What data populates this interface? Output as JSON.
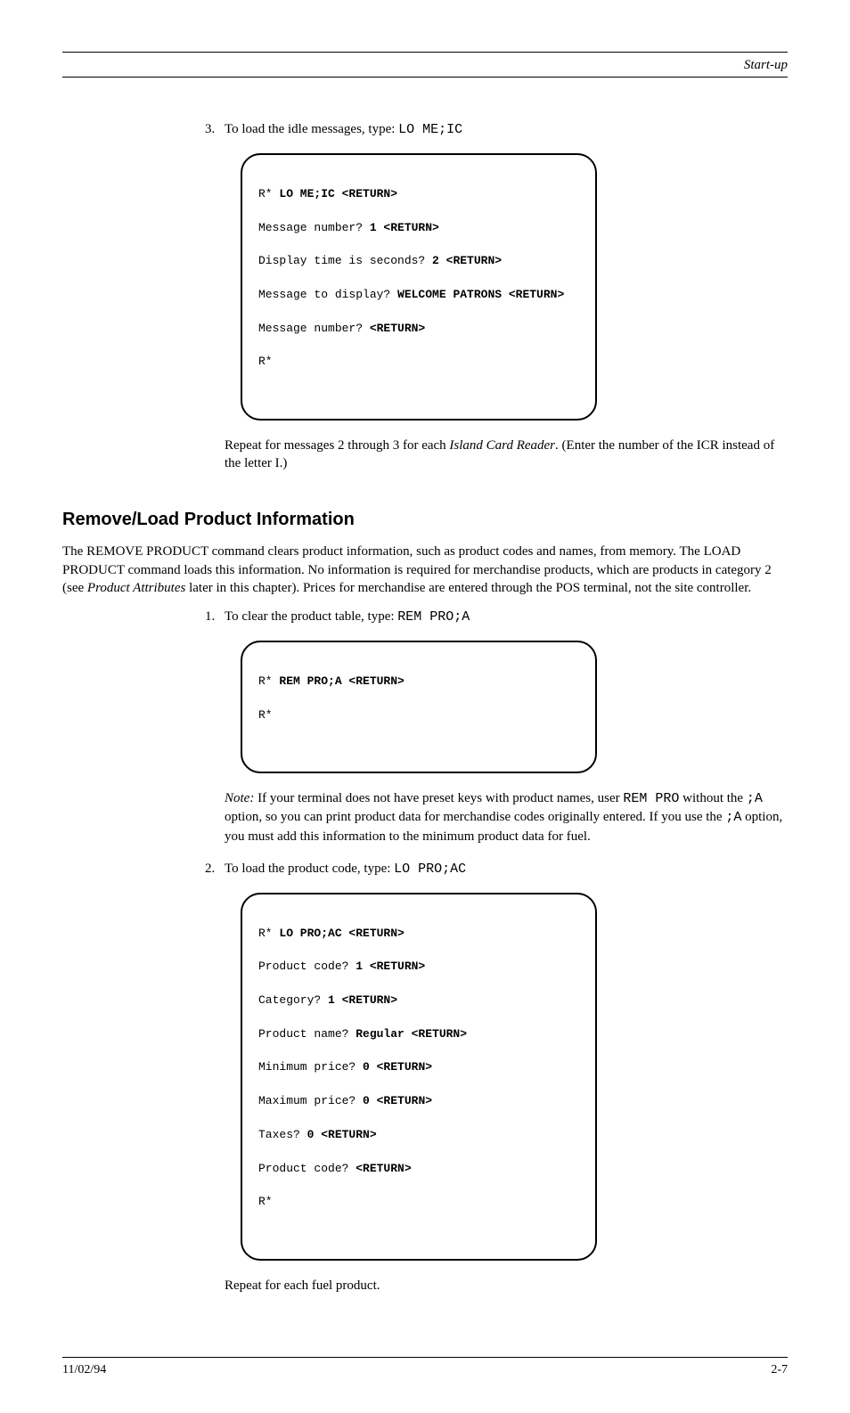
{
  "header": {
    "right": "Start-up"
  },
  "step1": {
    "num": "3.",
    "text_a": "To load the idle messages, type: ",
    "cmd": "LO ME;IC"
  },
  "box1": {
    "l1_prompt": "R* ",
    "l1_cmd": "LO ME;IC <RETURN>",
    "l2_prompt": "Message number? ",
    "l2_cmd": "1 <RETURN>",
    "l3_prompt": "Display time is seconds? ",
    "l3_cmd": "2 <RETURN>",
    "l4_prompt": "Message to display? ",
    "l4_cmd": "WELCOME PATRONS <RETURN>",
    "l5_prompt": "Message number? ",
    "l5_cmd": "<RETURN>",
    "l6_prompt": "R*"
  },
  "post1": {
    "text_a": "Repeat for messages 2 through 3 for each ",
    "text_em": "Island Card Reader",
    "text_b": ". (Enter the number of the ICR instead of the letter I.)"
  },
  "section2": {
    "title": "Remove/Load Product Information",
    "para_a": "The REMOVE PRODUCT command clears product information, such as product codes and names, from memory. The LOAD PRODUCT command loads this information. No information is required for merchandise products, which are products in category 2 (see ",
    "para_em": "Product Attributes",
    "para_b": " later in this chapter). Prices for merchandise are entered through the POS terminal, not the site controller."
  },
  "step2a": {
    "num": "1.",
    "text": "To clear the product table, type: ",
    "cmd": "REM PRO;A"
  },
  "box2": {
    "l1_prompt": "R* ",
    "l1_cmd": "REM PRO;A <RETURN>",
    "l2_prompt": "R*"
  },
  "note": {
    "label": "Note: ",
    "text_a": "If your terminal does not have preset keys with product names, user ",
    "code": "REM PRO",
    "text_b": " without the ",
    "code2": ";A",
    "text_c": " option, so you can print product data for merchandise codes originally entered. If you use the ",
    "code3": ";A",
    "text_d": " option, you must add this information to the minimum product data for fuel."
  },
  "step2b": {
    "num": "2.",
    "text": "To load the product code, type: ",
    "cmd": "LO PRO;AC"
  },
  "box3": {
    "l1_prompt": "R* ",
    "l1_cmd": "LO PRO;AC <RETURN>",
    "l2_prompt": "Product code? ",
    "l2_cmd": "1 <RETURN>",
    "l3_prompt": "Category? ",
    "l3_cmd": "1 <RETURN>",
    "l4_prompt": "Product name? ",
    "l4_cmd": "Regular <RETURN>",
    "l5_prompt": "Minimum price? ",
    "l5_cmd": "0 <RETURN>",
    "l6_prompt": "Maximum price? ",
    "l6_cmd": "0 <RETURN>",
    "l7_prompt": "Taxes? ",
    "l7_cmd": "0 <RETURN>",
    "l8_prompt": "Product code? ",
    "l8_cmd": "<RETURN>",
    "l9_prompt": "R*"
  },
  "post3": "Repeat for each fuel product.",
  "footer": {
    "left": "11/02/94",
    "right": "2-7"
  }
}
